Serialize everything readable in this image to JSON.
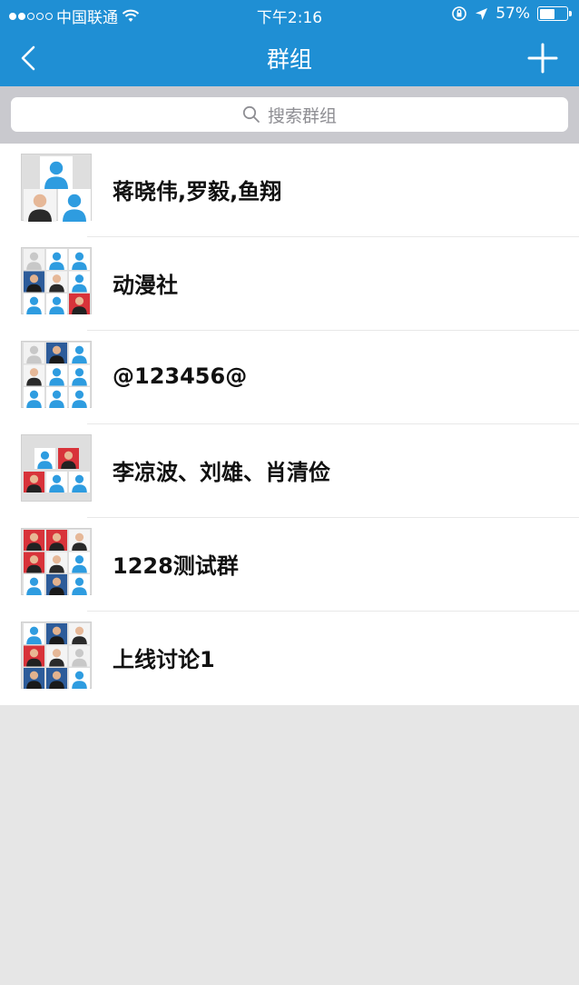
{
  "status_bar": {
    "carrier": "中国联通",
    "time": "下午2:16",
    "battery_percent": "57%",
    "battery_level": 0.57
  },
  "nav": {
    "title": "群组",
    "back_icon": "chevron-left-icon",
    "add_icon": "plus-icon"
  },
  "search": {
    "placeholder": "搜索群组",
    "icon": "search-icon"
  },
  "groups": [
    {
      "name": "蒋晓伟,罗毅,鱼翔",
      "avatar_layout": "3"
    },
    {
      "name": "动漫社",
      "avatar_layout": "9"
    },
    {
      "name": "@123456@",
      "avatar_layout": "9"
    },
    {
      "name": "李凉波、刘雄、肖清俭",
      "avatar_layout": "5"
    },
    {
      "name": "1228测试群",
      "avatar_layout": "9"
    },
    {
      "name": "上线讨论1",
      "avatar_layout": "9"
    }
  ],
  "colors": {
    "brand_blue": "#1f8fd4",
    "search_bg": "#c9c9ce",
    "page_bg": "#e6e6e6"
  }
}
